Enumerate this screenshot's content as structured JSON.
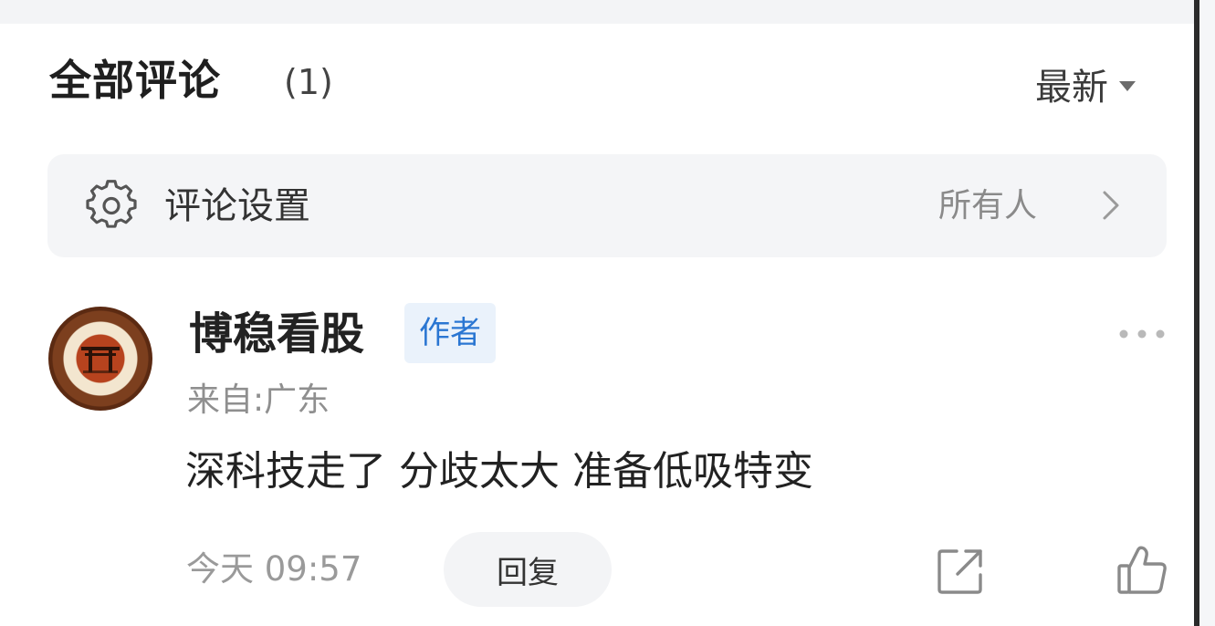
{
  "header": {
    "title": "全部评论",
    "count": "(1)",
    "sort_label": "最新"
  },
  "settings": {
    "label": "评论设置",
    "value": "所有人"
  },
  "comment": {
    "author": "博稳看股",
    "badge": "作者",
    "location": "来自:广东",
    "text": "深科技走了 分歧太大 准备低吸特变",
    "time": "今天 09:57",
    "reply_label": "回复"
  },
  "icons": {
    "settings": "gear-icon",
    "settings_arrow": "chevron-right-icon",
    "sort": "caret-down-icon",
    "more": "more-dots-icon",
    "share": "share-icon",
    "like": "thumbs-up-icon"
  },
  "colors": {
    "accent": "#2a76d2",
    "badge_bg": "#eaf2fb",
    "bar_bg": "#f4f5f7"
  }
}
